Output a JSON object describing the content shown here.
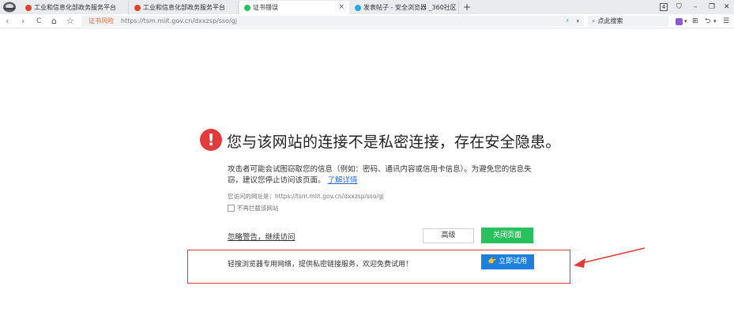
{
  "tabs": [
    {
      "label": "工业和信息化部政务服务平台",
      "icon_color": "#e0452b",
      "close": ""
    },
    {
      "label": "工业和信息化部政务服务平台",
      "icon_color": "#e0452b",
      "close": ""
    },
    {
      "label": "证书错误",
      "icon_color": "#27c25d",
      "close": "×"
    },
    {
      "label": "发表帖子 - 安全浏览器 _360社区",
      "icon_color": "#2aa8e0",
      "close": ""
    }
  ],
  "tabbar": {
    "new_tab": "+",
    "tab_count": "4"
  },
  "nav": {
    "back": "‹",
    "forward": "›",
    "reload": "C",
    "home": "⌂",
    "favorite": "☆"
  },
  "address": {
    "cert_label": "证书风险",
    "url": "https://tsm.miit.gov.cn/dxxzsp/sso/gj",
    "bolt": "⚡",
    "dropdown": "▾"
  },
  "search": {
    "placeholder": "点此搜索",
    "icon": "⌕"
  },
  "toolbar": {
    "ext_arrow": "▾",
    "grid": "⊞",
    "undo": "⮌",
    "undo_arrow": "▾",
    "menu": "☰"
  },
  "window": {
    "shirt": "⛉",
    "minimize": "–",
    "restore": "❐",
    "close": "✕"
  },
  "warning": {
    "icon": "!",
    "headline": "您与该网站的连接不是私密连接，存在安全隐患。",
    "description": "攻击者可能会试图窃取您的信息（例如：密码、通讯内容或信用卡信息）。为避免您的信息失窃，建议您停止访问该页面。",
    "learn_more": "了解详情",
    "visited_url": "您访问的网址是：https://tsm.miit.gov.cn/dxxzsp/sso/gj",
    "no_block_label": "不再拦截该网站",
    "ignore_link": "忽略警告，继续访问",
    "advanced_button": "高级",
    "close_page_button": "关闭页面"
  },
  "promo": {
    "text": "轻搜浏览器专用网络，提供私密链接服务，欢迎免费试用！",
    "try_button": "立即试用",
    "hand": "👉"
  },
  "colors": {
    "accent_green": "#27c25d",
    "accent_blue": "#1f7fe0",
    "warning_red": "#e33b3b",
    "annotation_red": "#e03a3a"
  }
}
